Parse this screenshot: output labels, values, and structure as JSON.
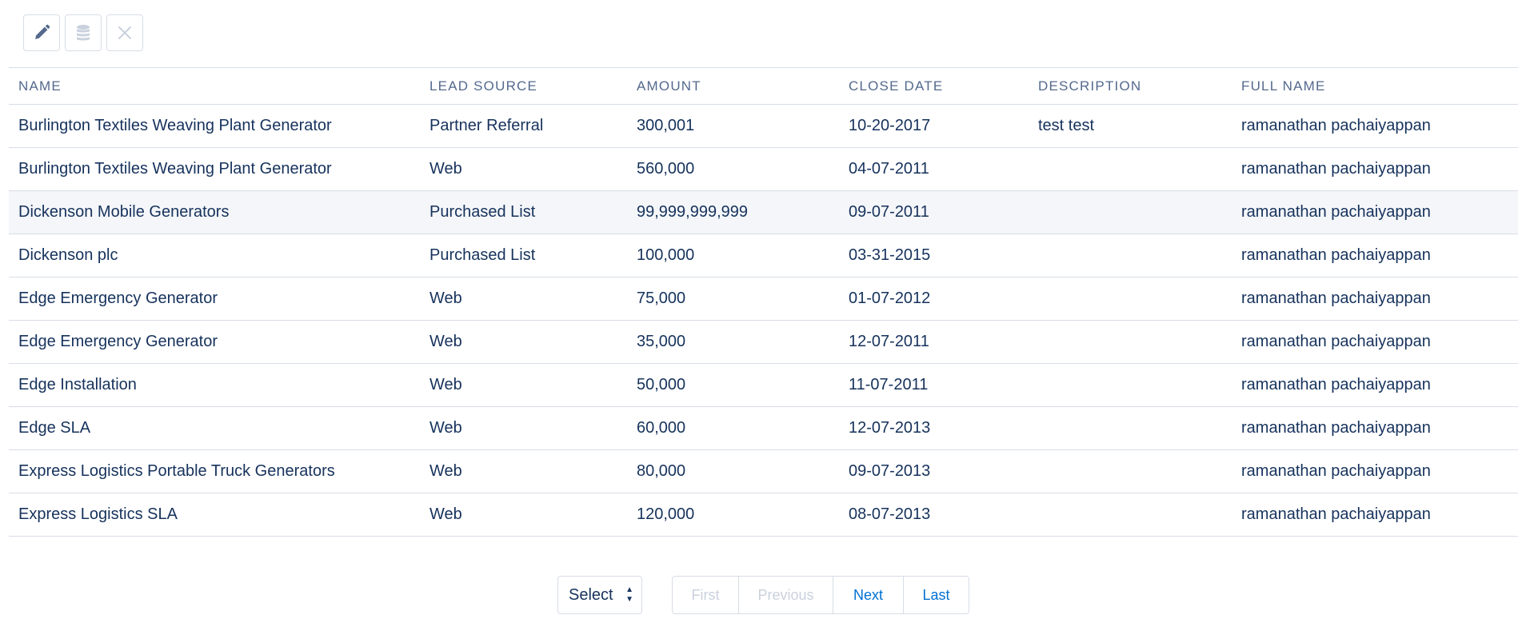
{
  "toolbar": {
    "buttons": [
      {
        "icon": "pencil-icon",
        "enabled": true
      },
      {
        "icon": "database-icon",
        "enabled": false
      },
      {
        "icon": "close-icon",
        "enabled": false
      }
    ]
  },
  "table": {
    "columns": [
      "NAME",
      "LEAD SOURCE",
      "AMOUNT",
      "CLOSE DATE",
      "DESCRIPTION",
      "FULL NAME"
    ],
    "rows": [
      [
        "Burlington Textiles Weaving Plant Generator",
        "Partner Referral",
        "300,001",
        "10-20-2017",
        "test test",
        "ramanathan pachaiyappan"
      ],
      [
        "Burlington Textiles Weaving Plant Generator",
        "Web",
        "560,000",
        "04-07-2011",
        "",
        "ramanathan pachaiyappan"
      ],
      [
        "Dickenson Mobile Generators",
        "Purchased List",
        "99,999,999,999",
        "09-07-2011",
        "",
        "ramanathan pachaiyappan"
      ],
      [
        "Dickenson plc",
        "Purchased List",
        "100,000",
        "03-31-2015",
        "",
        "ramanathan pachaiyappan"
      ],
      [
        "Edge Emergency Generator",
        "Web",
        "75,000",
        "01-07-2012",
        "",
        "ramanathan pachaiyappan"
      ],
      [
        "Edge Emergency Generator",
        "Web",
        "35,000",
        "12-07-2011",
        "",
        "ramanathan pachaiyappan"
      ],
      [
        "Edge Installation",
        "Web",
        "50,000",
        "11-07-2011",
        "",
        "ramanathan pachaiyappan"
      ],
      [
        "Edge SLA",
        "Web",
        "60,000",
        "12-07-2013",
        "",
        "ramanathan pachaiyappan"
      ],
      [
        "Express Logistics Portable Truck Generators",
        "Web",
        "80,000",
        "09-07-2013",
        "",
        "ramanathan pachaiyappan"
      ],
      [
        "Express Logistics SLA",
        "Web",
        "120,000",
        "08-07-2013",
        "",
        "ramanathan pachaiyappan"
      ]
    ],
    "hovered_row": 2
  },
  "pagination": {
    "page_size": {
      "selected": "Select"
    },
    "first_label": "First",
    "previous_label": "Previous",
    "next_label": "Next",
    "last_label": "Last"
  },
  "colors": {
    "text": "#16325c",
    "header_text": "#54698d",
    "border": "#d8dde6",
    "link": "#0070d2",
    "disabled": "#c9d1dd",
    "row_hover": "#f4f6f9"
  }
}
